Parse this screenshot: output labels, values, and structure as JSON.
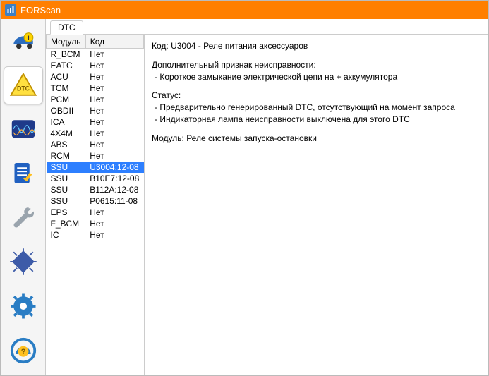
{
  "window": {
    "title": "FORScan"
  },
  "tabs": [
    {
      "label": "DTC"
    }
  ],
  "table": {
    "headers": {
      "module": "Модуль",
      "code": "Код"
    },
    "rows": [
      {
        "module": "R_BCM",
        "code": "Нет",
        "selected": false
      },
      {
        "module": "EATC",
        "code": "Нет",
        "selected": false
      },
      {
        "module": "ACU",
        "code": "Нет",
        "selected": false
      },
      {
        "module": "TCM",
        "code": "Нет",
        "selected": false
      },
      {
        "module": "PCM",
        "code": "Нет",
        "selected": false
      },
      {
        "module": "OBDII",
        "code": "Нет",
        "selected": false
      },
      {
        "module": "ICA",
        "code": "Нет",
        "selected": false
      },
      {
        "module": "4X4M",
        "code": "Нет",
        "selected": false
      },
      {
        "module": "ABS",
        "code": "Нет",
        "selected": false
      },
      {
        "module": "RCM",
        "code": "Нет",
        "selected": false
      },
      {
        "module": "SSU",
        "code": "U3004:12-08",
        "selected": true
      },
      {
        "module": "SSU",
        "code": "B10E7:12-08",
        "selected": false
      },
      {
        "module": "SSU",
        "code": "B112A:12-08",
        "selected": false
      },
      {
        "module": "SSU",
        "code": "P0615:11-08",
        "selected": false
      },
      {
        "module": "EPS",
        "code": "Нет",
        "selected": false
      },
      {
        "module": "F_BCM",
        "code": "Нет",
        "selected": false
      },
      {
        "module": "IC",
        "code": "Нет",
        "selected": false
      }
    ]
  },
  "details": {
    "code_line": "Код: U3004 - Реле питания аксессуаров",
    "sub_heading": "Дополнительный признак неисправности:",
    "sub_line": " - Короткое замыкание электрической цепи на + аккумулятора",
    "status_heading": "Статус:",
    "status_line1": " - Предварительно генерированный DTC, отсутствующий на момент запроса",
    "status_line2": " - Индикаторная лампа неисправности выключена для этого DTC",
    "module_line": "Модуль: Реле системы запуска-остановки"
  }
}
